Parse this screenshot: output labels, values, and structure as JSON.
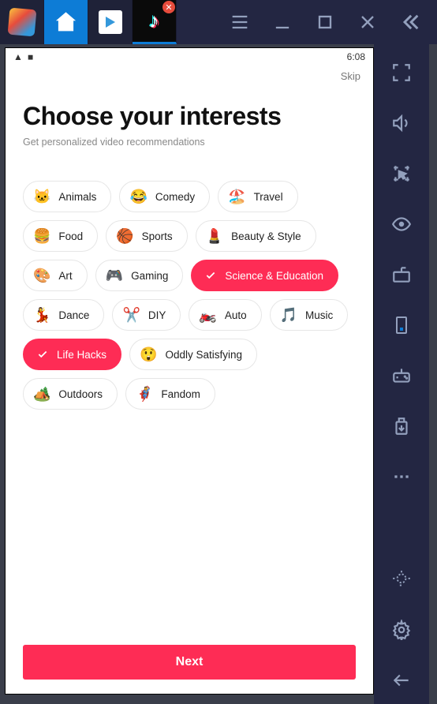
{
  "status": {
    "time": "6:08"
  },
  "skip_label": "Skip",
  "title": "Choose your interests",
  "subtitle": "Get personalized video recommendations",
  "interests": [
    {
      "emoji": "🐱",
      "label": "Animals",
      "selected": false
    },
    {
      "emoji": "😂",
      "label": "Comedy",
      "selected": false
    },
    {
      "emoji": "🏖️",
      "label": "Travel",
      "selected": false
    },
    {
      "emoji": "🍔",
      "label": "Food",
      "selected": false
    },
    {
      "emoji": "🏀",
      "label": "Sports",
      "selected": false
    },
    {
      "emoji": "💄",
      "label": "Beauty & Style",
      "selected": false
    },
    {
      "emoji": "🎨",
      "label": "Art",
      "selected": false
    },
    {
      "emoji": "🎮",
      "label": "Gaming",
      "selected": false
    },
    {
      "emoji": "",
      "label": "Science & Education",
      "selected": true
    },
    {
      "emoji": "💃",
      "label": "Dance",
      "selected": false
    },
    {
      "emoji": "✂️",
      "label": "DIY",
      "selected": false
    },
    {
      "emoji": "🏍️",
      "label": "Auto",
      "selected": false
    },
    {
      "emoji": "🎵",
      "label": "Music",
      "selected": false
    },
    {
      "emoji": "",
      "label": "Life Hacks",
      "selected": true
    },
    {
      "emoji": "😲",
      "label": "Oddly Satisfying",
      "selected": false
    },
    {
      "emoji": "🏕️",
      "label": "Outdoors",
      "selected": false
    },
    {
      "emoji": "🦸",
      "label": "Fandom",
      "selected": false
    }
  ],
  "next_label": "Next"
}
